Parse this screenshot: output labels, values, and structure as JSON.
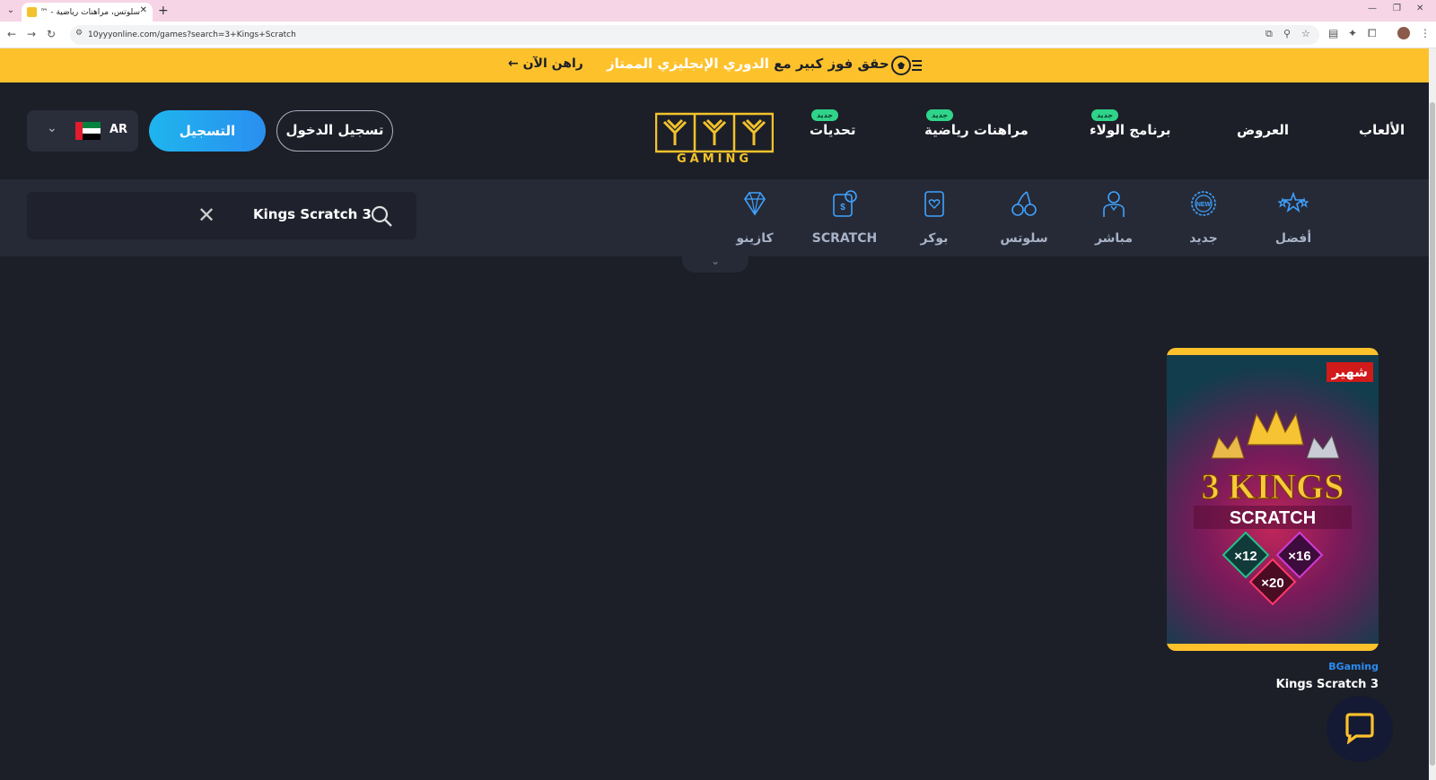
{
  "browser": {
    "tab_title": "سلوتس، مراهنات رياضية - ™YYY",
    "url": "10yyyonline.com/games?search=3+Kings+Scratch"
  },
  "promo": {
    "cta": "راهن الآن ←",
    "text_prefix": "حقق فوز كبير مع ",
    "text_highlight": "الدوري الإنجليزي الممتاز"
  },
  "nav": {
    "games": "الألعاب",
    "offers": "العروض",
    "loyalty": "برنامج الولاء",
    "sports": "مراهنات رياضية",
    "challenges": "تحديات",
    "new_badge": "جديد"
  },
  "logo": {
    "text": "GAMING"
  },
  "auth": {
    "login": "تسجيل الدخول",
    "register": "التسجيل"
  },
  "language": {
    "code": "AR"
  },
  "search": {
    "query": "Kings Scratch 3"
  },
  "categories": [
    {
      "label": "أفضل"
    },
    {
      "label": "جديد"
    },
    {
      "label": "مباشر"
    },
    {
      "label": "سلوتس"
    },
    {
      "label": "بوكر"
    },
    {
      "label": "SCRATCH"
    },
    {
      "label": "كازينو"
    }
  ],
  "results": [
    {
      "badge": "شهير",
      "provider": "BGaming",
      "name": "Kings Scratch 3",
      "art_title": "3 KINGS",
      "art_sub": "SCRATCH",
      "multipliers": [
        "×12",
        "×16",
        "×20"
      ]
    }
  ],
  "colors": {
    "accent": "#fdc12c",
    "register": "#2a8ff0",
    "new_badge": "#2fd48a",
    "hot": "#d11a1a"
  }
}
